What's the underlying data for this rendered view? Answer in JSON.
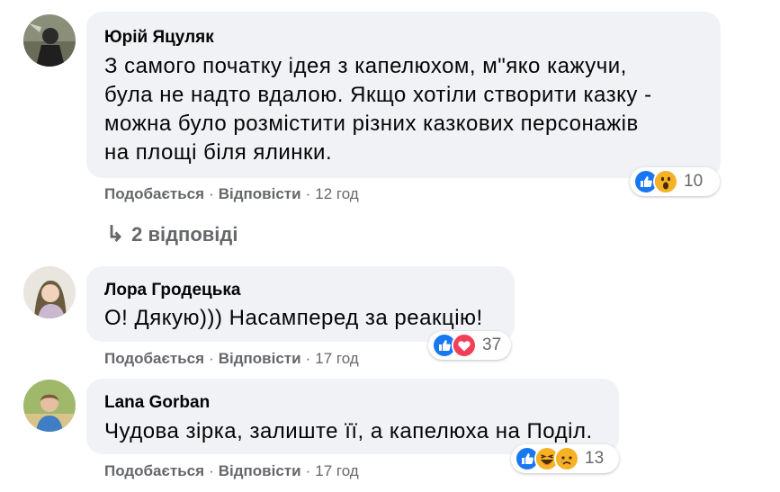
{
  "comments": [
    {
      "author": "Юрій Яцуляк",
      "text_lines": [
        "З самого початку ідея з капелюхом, м\"яко кажучи,",
        "була не надто вдалою. Якщо хотіли створити казку -",
        "можна було розмістити різних казкових персонажів",
        "на площі біля ялинки."
      ],
      "like_label": "Подобається",
      "reply_label": "Відповісти",
      "time": "12 год",
      "reactions": [
        "like",
        "wow"
      ],
      "reaction_count": "10",
      "replies_label": "2 відповіді"
    },
    {
      "author": "Лора Гродецька",
      "text_lines": [
        "О! Дякую))) Насамперед за реакцію!"
      ],
      "like_label": "Подобається",
      "reply_label": "Відповісти",
      "time": "17 год",
      "reactions": [
        "like",
        "love"
      ],
      "reaction_count": "37"
    },
    {
      "author": "Lana Gorban",
      "text_lines": [
        "Чудова зірка, залиште її, а капелюха на Поділ."
      ],
      "like_label": "Подобається",
      "reply_label": "Відповісти",
      "time": "17 год",
      "reactions": [
        "like",
        "haha",
        "sad"
      ],
      "reaction_count": "13"
    }
  ],
  "separator": "·",
  "colors": {
    "bubble": "#f0f2f5",
    "secondary_text": "#65676b",
    "like_blue": "#1877f2",
    "love_red": "#f33e58",
    "emoji_yellow": "#f7b125"
  }
}
